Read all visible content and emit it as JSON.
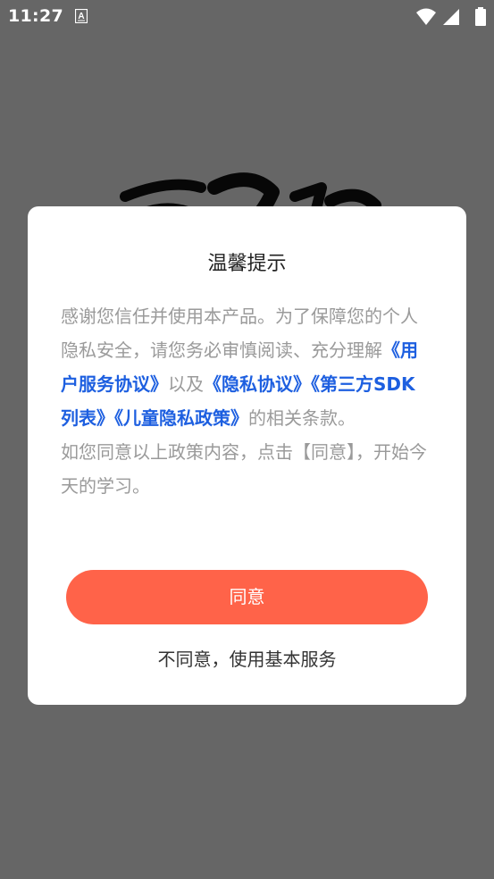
{
  "status_bar": {
    "time": "11:27",
    "icons": [
      "notification-a-icon",
      "wifi-icon",
      "cellular-signal-icon",
      "battery-icon"
    ],
    "color": "#ffffff"
  },
  "background": {
    "logo": "calligraphy-logo"
  },
  "dialog": {
    "title": "温馨提示",
    "body": {
      "p1_text1": "感谢您信任并使用本产品。为了保障您的个人隐私安全，请您务必审慎阅读、充分理解",
      "link_user_agreement": "《用户服务协议》",
      "p1_text2": "以及",
      "link_privacy": "《隐私协议》",
      "link_sdk_list": "《第三方SDK列表》",
      "link_child_privacy": "《儿童隐私政策》",
      "p1_text3": "的相关条款。",
      "p2": "如您同意以上政策内容，点击【同意】，开始今天的学习。"
    },
    "agree_label": "同意",
    "disagree_label": "不同意，使用基本服务"
  },
  "colors": {
    "accent": "#ff6349",
    "link": "#1d5fe0",
    "body_text": "#9a9a9a",
    "scrim": "rgba(0,0,0,0.58)"
  }
}
